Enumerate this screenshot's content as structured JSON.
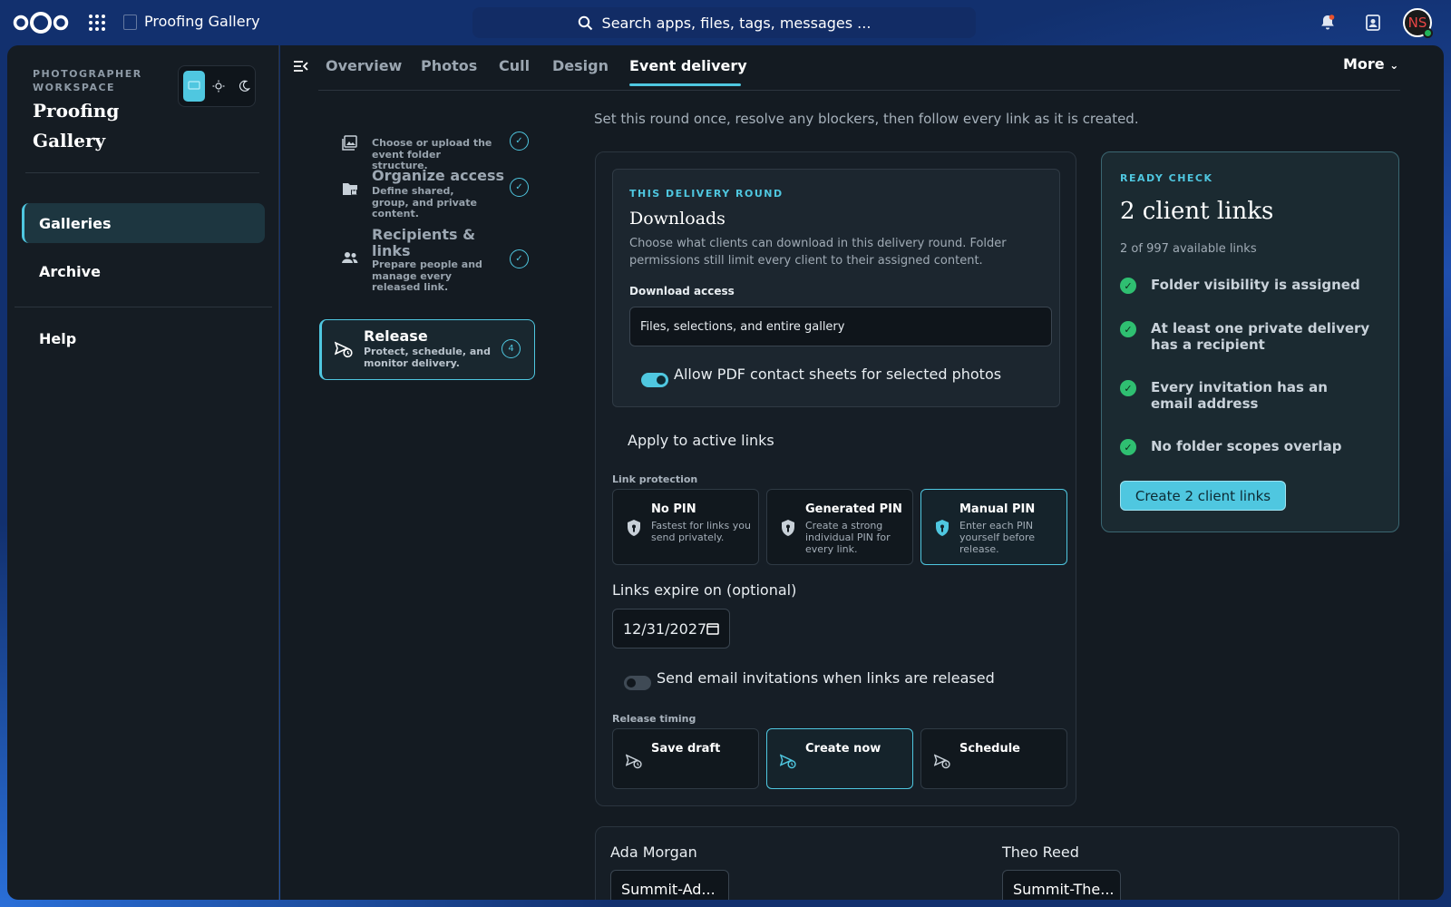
{
  "topbar": {
    "app_title": "Proofing Gallery",
    "search_placeholder": "Search apps, files, tags, messages ...",
    "avatar_initials": "NS"
  },
  "sidebar": {
    "workspace_label": "PHOTOGRAPHER WORKSPACE",
    "workspace_title_line1": "Proofing",
    "workspace_title_line2": "Gallery",
    "items": [
      {
        "label": "Galleries",
        "active": true
      },
      {
        "label": "Archive",
        "active": false
      }
    ],
    "help_label": "Help"
  },
  "tabs": [
    {
      "label": "Overview"
    },
    {
      "label": "Photos"
    },
    {
      "label": "Cull"
    },
    {
      "label": "Design"
    },
    {
      "label": "Event delivery",
      "active": true
    }
  ],
  "more_label": "More",
  "steps": [
    {
      "desc": "Choose or upload the event folder structure.",
      "icon": "image-icon",
      "status": "✓"
    },
    {
      "title": "Organize access",
      "desc": "Define shared, group, and private content.",
      "icon": "folder-lock-icon",
      "status": "✓"
    },
    {
      "title": "Recipients & links",
      "desc": "Prepare people and manage every released link.",
      "icon": "people-icon",
      "status": "✓"
    },
    {
      "title": "Release",
      "desc": "Protect, schedule, and monitor delivery.",
      "icon": "send-clock-icon",
      "status": "4",
      "active": true
    }
  ],
  "intro": "Set this round once, resolve any blockers, then follow every link as it is created.",
  "delivery": {
    "kicker": "THIS DELIVERY ROUND",
    "title": "Downloads",
    "description": "Choose what clients can download in this delivery round. Folder permissions still limit every client to their assigned content.",
    "download_access_label": "Download access",
    "download_access_value": "Files, selections, and entire gallery",
    "pdf_toggle_label": "Allow PDF contact sheets for selected photos",
    "pdf_toggle_on": true,
    "apply_label": "Apply to active links",
    "link_protection_label": "Link protection",
    "pin_options": [
      {
        "title": "No PIN",
        "desc": "Fastest for links you send privately."
      },
      {
        "title": "Generated PIN",
        "desc": "Create a strong individual PIN for every link."
      },
      {
        "title": "Manual PIN",
        "desc": "Enter each PIN yourself before release.",
        "selected": true
      }
    ],
    "expiry_label": "Links expire on (optional)",
    "expiry_value": "12/31/2027",
    "email_toggle_label": "Send email invitations when links are released",
    "email_toggle_on": false,
    "release_timing_label": "Release timing",
    "timing_options": [
      {
        "title": "Save draft"
      },
      {
        "title": "Create now",
        "selected": true
      },
      {
        "title": "Schedule"
      }
    ]
  },
  "ready": {
    "kicker": "READY CHECK",
    "title": "2 client links",
    "subtitle": "2 of 997 available links",
    "checks": [
      "Folder visibility is assigned",
      "At least one private delivery has a recipient",
      "Every invitation has an email address",
      "No folder scopes overlap"
    ],
    "button_label": "Create 2 client links"
  },
  "recipients": [
    {
      "name": "Ada Morgan",
      "link": "Summit-Ad..."
    },
    {
      "name": "Theo Reed",
      "link": "Summit-The..."
    }
  ],
  "colors": {
    "accent": "#4fc7e0",
    "success": "#2fbf71",
    "surface": "#141b22"
  }
}
